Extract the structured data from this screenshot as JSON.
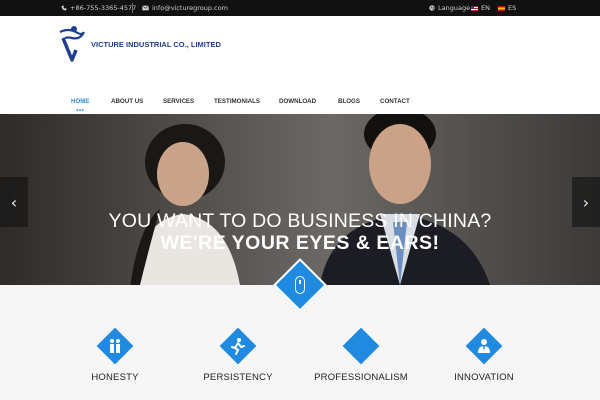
{
  "topbar": {
    "phone": "+86-755-3365-4577",
    "email": "info@victuregroup.com",
    "language_label": "Language :",
    "languages": [
      "EN",
      "ES"
    ]
  },
  "header": {
    "company_name": "VICTURE INDUSTRIAL CO., LIMITED"
  },
  "nav": {
    "items": [
      "HOME",
      "ABOUT US",
      "SERVICES",
      "TESTIMONIALS",
      "DOWNLOAD",
      "BLOGS",
      "CONTACT"
    ],
    "active": "HOME",
    "active_marker": "•••"
  },
  "hero": {
    "line1": "YOU WANT TO DO BUSINESS IN CHINA?",
    "line2": "WE'RE YOUR EYES & EARS!",
    "prev_arrow": "‹",
    "next_arrow": "›"
  },
  "values": [
    {
      "label": "HONESTY",
      "icon": "people-icon"
    },
    {
      "label": "PERSISTENCY",
      "icon": "runner-icon"
    },
    {
      "label": "PROFESSIONALISM",
      "icon": "diamond-icon"
    },
    {
      "label": "INNOVATION",
      "icon": "person-icon"
    }
  ],
  "colors": {
    "accent": "#1f8ae0",
    "brand": "#1e3f8f",
    "topbar_bg": "#111111"
  }
}
